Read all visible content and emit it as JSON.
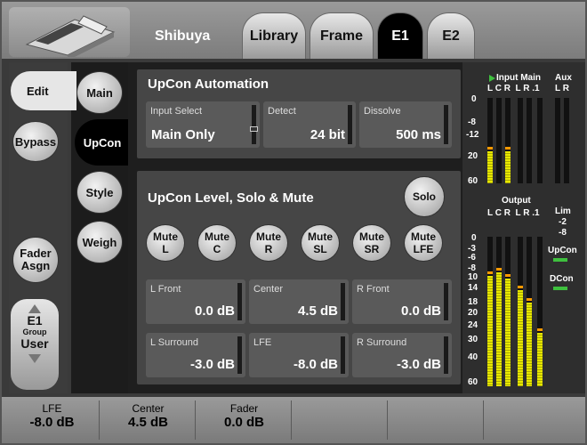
{
  "header": {
    "app_name": "Shibuya",
    "tabs": [
      "Library",
      "Frame",
      "E1",
      "E2"
    ],
    "active_tab": "E1"
  },
  "left_nav": {
    "items": [
      "Edit",
      "Bypass",
      "Fader Asgn"
    ],
    "active": "Edit",
    "group": {
      "line1": "E1",
      "line2": "Group",
      "line3": "User"
    }
  },
  "sub_nav": {
    "items": [
      "Main",
      "UpCon",
      "Style",
      "Weigh"
    ],
    "active": "UpCon"
  },
  "automation": {
    "title": "UpCon Automation",
    "fields": [
      {
        "label": "Input Select",
        "value": "Main Only",
        "level": 0.25
      },
      {
        "label": "Detect",
        "value": "24 bit",
        "level": 0
      },
      {
        "label": "Dissolve",
        "value": "500 ms",
        "level": 0
      }
    ]
  },
  "level_section": {
    "title": "UpCon Level, Solo & Mute",
    "solo_label": "Solo",
    "mutes": [
      {
        "line1": "Mute",
        "line2": "L"
      },
      {
        "line1": "Mute",
        "line2": "C"
      },
      {
        "line1": "Mute",
        "line2": "R"
      },
      {
        "line1": "Mute",
        "line2": "SL"
      },
      {
        "line1": "Mute",
        "line2": "SR"
      },
      {
        "line1": "Mute",
        "line2": "LFE"
      }
    ],
    "levels": [
      {
        "label": "L Front",
        "value": "0.0 dB"
      },
      {
        "label": "Center",
        "value": "4.5 dB"
      },
      {
        "label": "R Front",
        "value": "0.0 dB"
      },
      {
        "label": "L Surround",
        "value": "-3.0 dB"
      },
      {
        "label": "LFE",
        "value": "-8.0 dB"
      },
      {
        "label": "R Surround",
        "value": "-3.0 dB"
      }
    ]
  },
  "meters": {
    "input_title": "Input Main",
    "aux_title": "Aux",
    "input_channels": "L C R  L R .1",
    "aux_channels": "L R",
    "input_scale": [
      "0",
      "-8",
      "-12",
      "20",
      "60"
    ],
    "output_title": "Output",
    "output_channels": "L C R  L R .1",
    "output_scale": [
      "0",
      "-3",
      "-6",
      "-8",
      "10",
      "14",
      "18",
      "20",
      "24",
      "30",
      "40",
      "60"
    ],
    "lim_label": "Lim",
    "lim_values": [
      "-2",
      "-8"
    ],
    "upcon_label": "UpCon",
    "dcon_label": "DCon",
    "input_levels": [
      0.38,
      0,
      0.38,
      0,
      0,
      0
    ],
    "output_levels": [
      0.74,
      0.76,
      0.72,
      0.64,
      0.56,
      0.36
    ]
  },
  "bottom_bar": [
    {
      "label": "LFE",
      "value": "-8.0 dB"
    },
    {
      "label": "Center",
      "value": "4.5 dB"
    },
    {
      "label": "Fader",
      "value": "0.0 dB"
    },
    {
      "label": "",
      "value": ""
    },
    {
      "label": "",
      "value": ""
    },
    {
      "label": "",
      "value": ""
    }
  ]
}
